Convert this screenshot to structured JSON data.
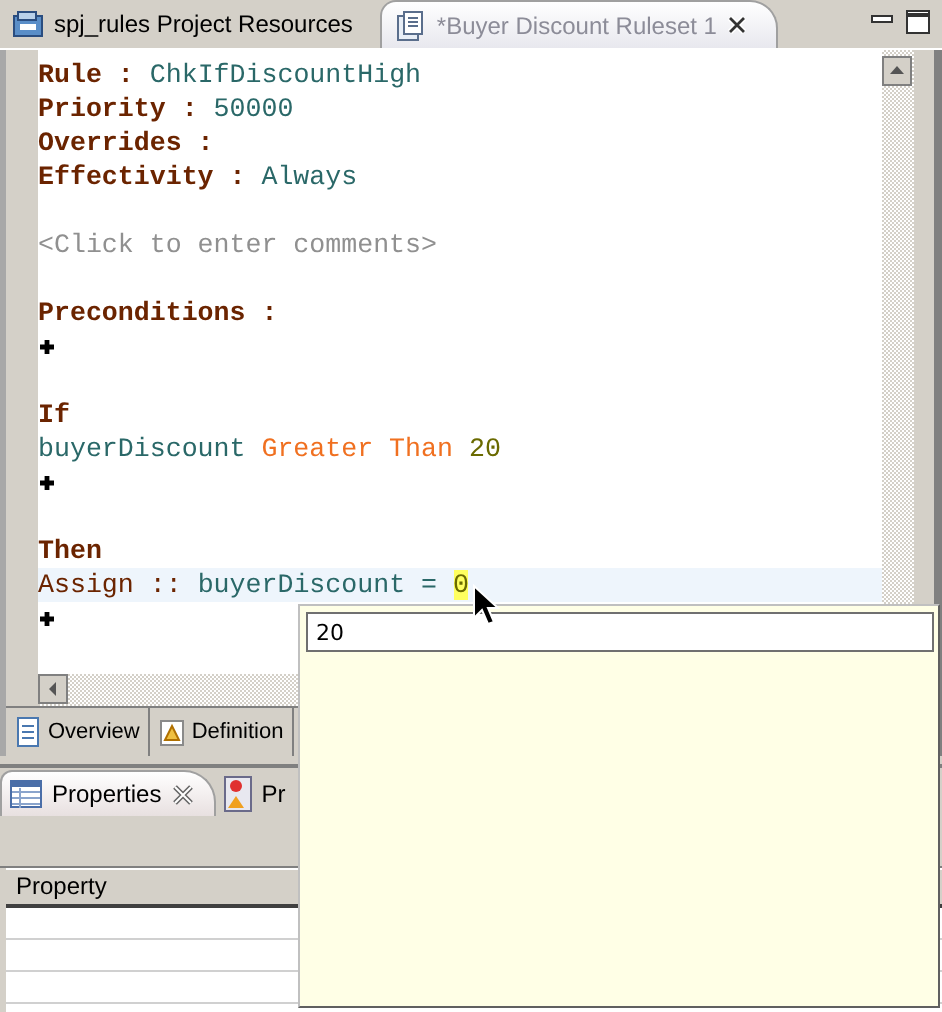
{
  "editor_tabs": [
    {
      "label": "spj_rules Project Resources",
      "selected": false,
      "closable": false
    },
    {
      "label": "*Buyer Discount Ruleset 1",
      "selected": true,
      "closable": true
    }
  ],
  "editor": {
    "lines": [
      {
        "kind": "code",
        "segments": [
          {
            "text": "Rule :",
            "kind": "keyword"
          },
          {
            "text": "ChkIfDiscountHigh",
            "kind": "value"
          }
        ]
      },
      {
        "kind": "code",
        "segments": [
          {
            "text": "Priority :",
            "kind": "keyword"
          },
          {
            "text": "50000",
            "kind": "value"
          }
        ]
      },
      {
        "kind": "code",
        "segments": [
          {
            "text": "Overrides :",
            "kind": "keyword"
          }
        ]
      },
      {
        "kind": "code",
        "segments": [
          {
            "text": "Effectivity :",
            "kind": "keyword"
          },
          {
            "text": "Always",
            "kind": "value"
          }
        ]
      },
      {
        "kind": "blank"
      },
      {
        "kind": "code",
        "segments": [
          {
            "text": "<Click to enter comments>",
            "kind": "comment"
          }
        ]
      },
      {
        "kind": "blank"
      },
      {
        "kind": "code",
        "segments": [
          {
            "text": "Preconditions :",
            "kind": "keyword"
          }
        ]
      },
      {
        "kind": "add"
      },
      {
        "kind": "blank"
      },
      {
        "kind": "code",
        "segments": [
          {
            "text": "If",
            "kind": "keyword"
          }
        ]
      },
      {
        "kind": "code",
        "segments": [
          {
            "text": "buyerDiscount",
            "kind": "value"
          },
          {
            "text": "Greater Than",
            "kind": "operator"
          },
          {
            "text": "20",
            "kind": "number"
          }
        ]
      },
      {
        "kind": "add"
      },
      {
        "kind": "blank"
      },
      {
        "kind": "code",
        "segments": [
          {
            "text": "Then",
            "kind": "keyword"
          }
        ]
      },
      {
        "kind": "code",
        "current": true,
        "segments": [
          {
            "text": "Assign ::",
            "kind": "action"
          },
          {
            "text": "buyerDiscount",
            "kind": "value"
          },
          {
            "text": "=",
            "kind": "value"
          },
          {
            "text": "0",
            "kind": "selection"
          }
        ]
      },
      {
        "kind": "add"
      }
    ]
  },
  "page_tabs": [
    {
      "label": "Overview"
    },
    {
      "label": "Definition"
    }
  ],
  "panel": {
    "tabs": [
      {
        "label": "Properties",
        "selected": true,
        "closable": true
      },
      {
        "label": "Pr",
        "selected": false,
        "closable": false
      }
    ],
    "table": {
      "columns": [
        "Property"
      ]
    }
  },
  "popup": {
    "value": "20"
  }
}
